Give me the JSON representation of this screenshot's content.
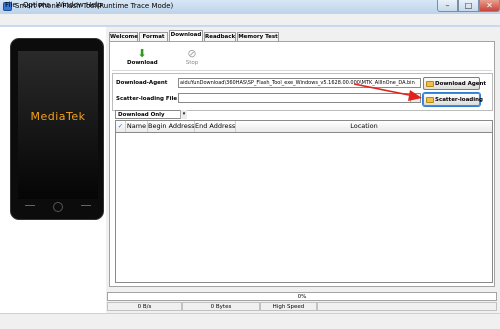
{
  "window": {
    "title": "Smart Phone Flash Tool(Runtime Trace Mode)",
    "minimize": "–",
    "maximize": "□",
    "close": "✕"
  },
  "menu": [
    "File",
    "Options",
    "Window",
    "Help"
  ],
  "device": {
    "brand": "MediaTek"
  },
  "tabs": [
    "Welcome",
    "Format",
    "Download",
    "Readback",
    "Memory Test"
  ],
  "active_tab": "Download",
  "toolbar": {
    "download_label": "Download",
    "stop_label": "Stop",
    "download_icon": "download-arrow-icon",
    "stop_icon": "stop-icon"
  },
  "download_agent": {
    "label": "Download-Agent",
    "value": "aiduYunDownload\\360HAS\\SP_Flash_Tool_exe_Windows_v5.1628.00.000\\MTK_AllInOne_DA.bin",
    "button": "Download Agent"
  },
  "scatter": {
    "label": "Scatter-loading File",
    "value": "",
    "button": "Scatter-loading"
  },
  "mode": {
    "selected": "Download Only"
  },
  "table": {
    "headers": [
      "✓",
      "Name",
      "Begin Address",
      "End Address",
      "Location"
    ],
    "rows": []
  },
  "status": {
    "progress": "0%",
    "speed": "0 B/s",
    "bytes": "0 Bytes",
    "mode": "High Speed"
  },
  "colors": {
    "brand_text": "#f4a21a",
    "annotation_arrow": "#e0241b",
    "download_icon": "#2f9a1d"
  }
}
